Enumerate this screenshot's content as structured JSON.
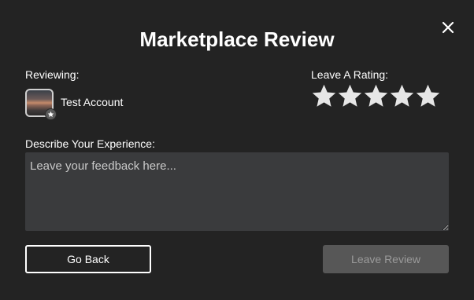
{
  "dialog": {
    "title": "Marketplace Review"
  },
  "reviewing": {
    "label": "Reviewing:",
    "account_name": "Test Account"
  },
  "rating": {
    "label": "Leave A Rating:",
    "max_stars": 5,
    "selected": 0,
    "star_color": "#e6e6e6"
  },
  "feedback": {
    "label": "Describe Your Experience:",
    "placeholder": "Leave your feedback here...",
    "value": ""
  },
  "buttons": {
    "back_label": "Go Back",
    "submit_label": "Leave Review"
  },
  "colors": {
    "background": "#232323",
    "input_background": "#3a3b3d",
    "disabled_button": "#575757",
    "disabled_text": "#9a9a9a"
  }
}
